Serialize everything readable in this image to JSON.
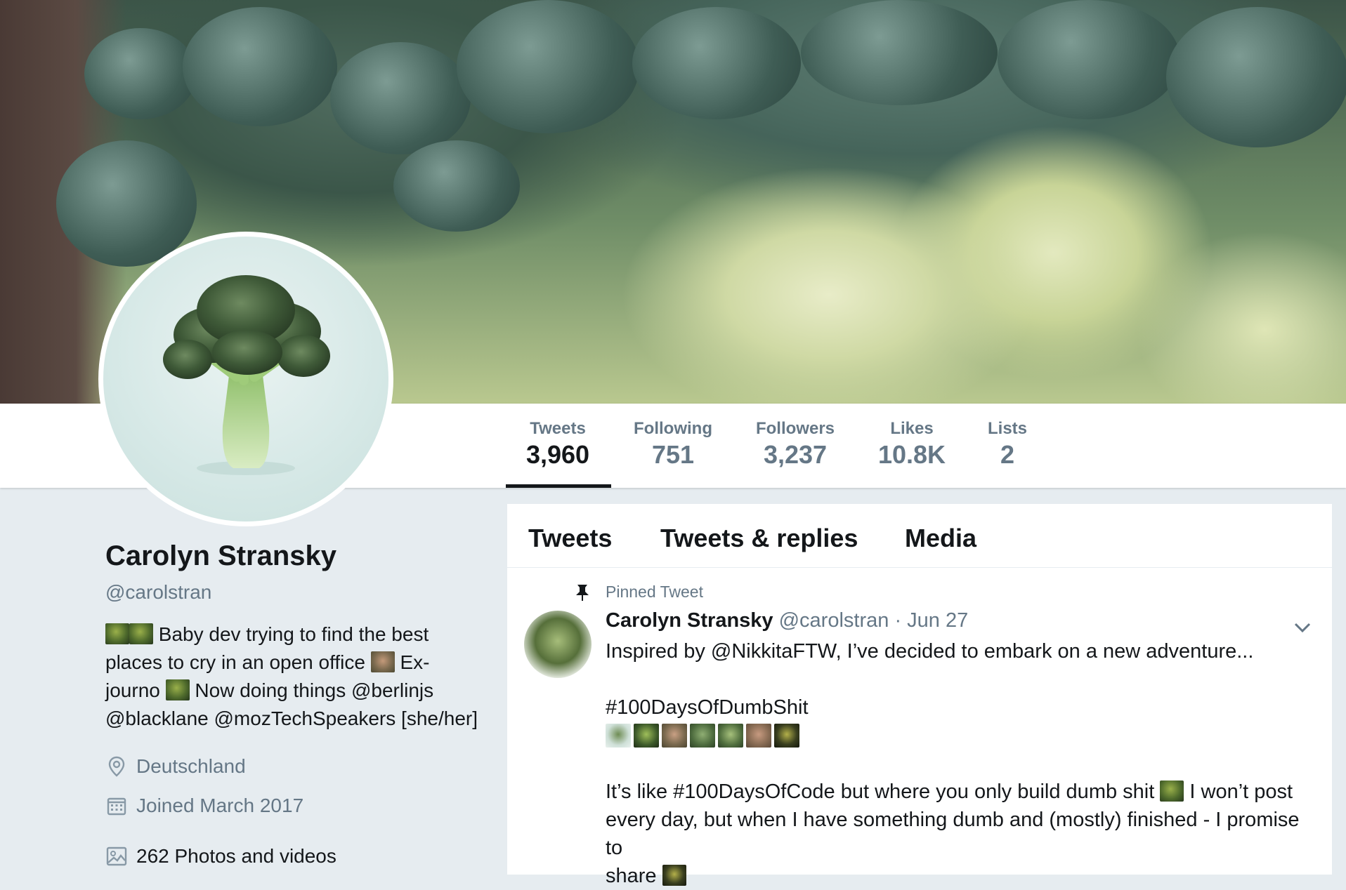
{
  "profile": {
    "name": "Carolyn Stransky",
    "handle": "@carolstran",
    "bio": {
      "line1": "Baby dev trying to find the best",
      "line2a": "places to cry in an open office",
      "line2b": "Ex-",
      "line3a": "journo",
      "line3b": "Now doing things @berlinjs",
      "line4": "@blacklane @mozTechSpeakers [she/her]"
    },
    "location": "Deutschland",
    "joined": "Joined March 2017",
    "media": "262 Photos and videos"
  },
  "stats": [
    {
      "label": "Tweets",
      "value": "3,960"
    },
    {
      "label": "Following",
      "value": "751"
    },
    {
      "label": "Followers",
      "value": "3,237"
    },
    {
      "label": "Likes",
      "value": "10.8K"
    },
    {
      "label": "Lists",
      "value": "2"
    }
  ],
  "tabs": {
    "tweets": "Tweets",
    "replies": "Tweets & replies",
    "media": "Media"
  },
  "tweet": {
    "pinned_label": "Pinned Tweet",
    "author": "Carolyn Stransky",
    "handle": "@carolstran",
    "date": "· Jun 27",
    "line1": "Inspired by @NikkitaFTW, I’ve decided to embark on a new adventure...",
    "hashtag": "#100DaysOfDumbShit",
    "para2a": "It’s like #100DaysOfCode but where you only build dumb shit",
    "para2b": "I won’t post",
    "para2c": "every day, but when I have something dumb and (mostly) finished - I promise to",
    "para2d": "share"
  },
  "colors": {
    "text_primary": "#14171a",
    "text_secondary": "#657786",
    "page_bg": "#e6ecf0"
  }
}
